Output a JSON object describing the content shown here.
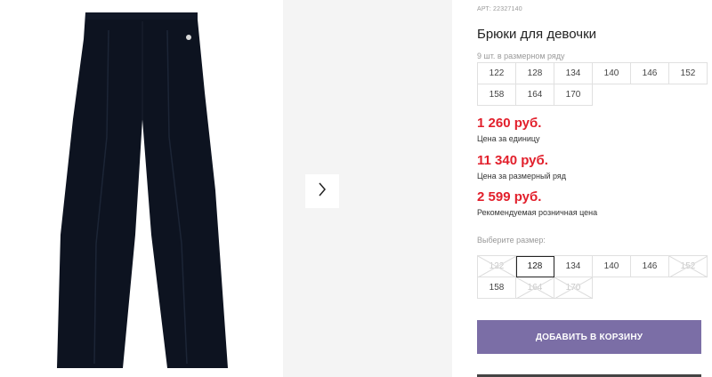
{
  "product": {
    "art_label": "АРТ:",
    "art_number": "22327140",
    "title": "Брюки для девочки"
  },
  "pack": {
    "label": "9 шт. в размерном ряду",
    "sizes": [
      "122",
      "128",
      "134",
      "140",
      "146",
      "152",
      "158",
      "164",
      "170"
    ]
  },
  "prices": [
    {
      "value": "1 260 руб.",
      "note": "Цена за единицу"
    },
    {
      "value": "11 340 руб.",
      "note": "Цена за размерный ряд"
    },
    {
      "value": "2 599 руб.",
      "note": "Рекомендуемая розничная цена"
    }
  ],
  "size_select": {
    "label": "Выберите размер:",
    "options": [
      {
        "label": "122",
        "state": "disabled"
      },
      {
        "label": "128",
        "state": "selected"
      },
      {
        "label": "134",
        "state": "available"
      },
      {
        "label": "140",
        "state": "available"
      },
      {
        "label": "146",
        "state": "available"
      },
      {
        "label": "152",
        "state": "disabled"
      },
      {
        "label": "158",
        "state": "available"
      },
      {
        "label": "164",
        "state": "disabled"
      },
      {
        "label": "170",
        "state": "disabled"
      }
    ]
  },
  "cart_button": "ДОБАВИТЬ В КОРЗИНУ",
  "icons": {
    "next": "chevron-right-icon"
  },
  "colors": {
    "price": "#e2202c",
    "accent": "#7b6ea6"
  }
}
